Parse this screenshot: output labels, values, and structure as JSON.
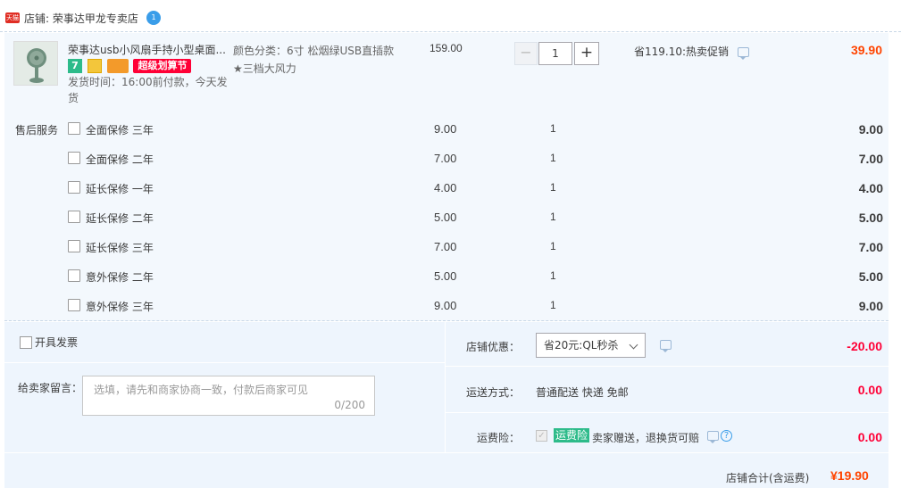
{
  "shop": {
    "badge": "天猫",
    "name": "店铺: 荣事达甲龙专卖店",
    "chat_badge": "1"
  },
  "product": {
    "title": "荣事达usb小风扇手持小型桌面...",
    "tag_seven": "7",
    "tag_promo": "超级划算节",
    "ship_time": "发货时间：16:00前付款，今天发货",
    "sku": "颜色分类：6寸 松烟绿USB直插款★三档大风力",
    "price": "159.00",
    "quantity": "1",
    "minus_symbol": "−",
    "plus_symbol": "+",
    "saved": "省119.10:热卖促销",
    "subtotal": "39.90"
  },
  "services": {
    "label": "售后服务",
    "items": [
      {
        "name": "全面保修 三年",
        "price": "9.00",
        "qty": "1",
        "sum": "9.00"
      },
      {
        "name": "全面保修 二年",
        "price": "7.00",
        "qty": "1",
        "sum": "7.00"
      },
      {
        "name": "延长保修 一年",
        "price": "4.00",
        "qty": "1",
        "sum": "4.00"
      },
      {
        "name": "延长保修 二年",
        "price": "5.00",
        "qty": "1",
        "sum": "5.00"
      },
      {
        "name": "延长保修 三年",
        "price": "7.00",
        "qty": "1",
        "sum": "7.00"
      },
      {
        "name": "意外保修 二年",
        "price": "5.00",
        "qty": "1",
        "sum": "5.00"
      },
      {
        "name": "意外保修 三年",
        "price": "9.00",
        "qty": "1",
        "sum": "9.00"
      }
    ]
  },
  "invoice": {
    "label": "开具发票"
  },
  "message": {
    "label": "给卖家留言：",
    "placeholder": "选填，请先和商家协商一致，付款后商家可见",
    "count": "0/200"
  },
  "coupon": {
    "label": "店铺优惠：",
    "selected": "省20元:QL秒杀",
    "value": "-20.00"
  },
  "delivery": {
    "label": "运送方式：",
    "method": "普通配送 快递 免邮",
    "value": "0.00"
  },
  "insurance": {
    "label": "运费险：",
    "check_mark": "✓",
    "tag": "运费险",
    "text": "卖家赠送，退换货可赔",
    "help": "?",
    "value": "0.00"
  },
  "total": {
    "label": "店铺合计(含运费)",
    "value": "¥19.90"
  },
  "colors": {
    "accent_red": "#ff0036",
    "price_orange": "#ff4400",
    "tag_green": "#2dbb8a",
    "link_blue": "#3a9de9",
    "panel_bg": "#f3f8fd"
  }
}
